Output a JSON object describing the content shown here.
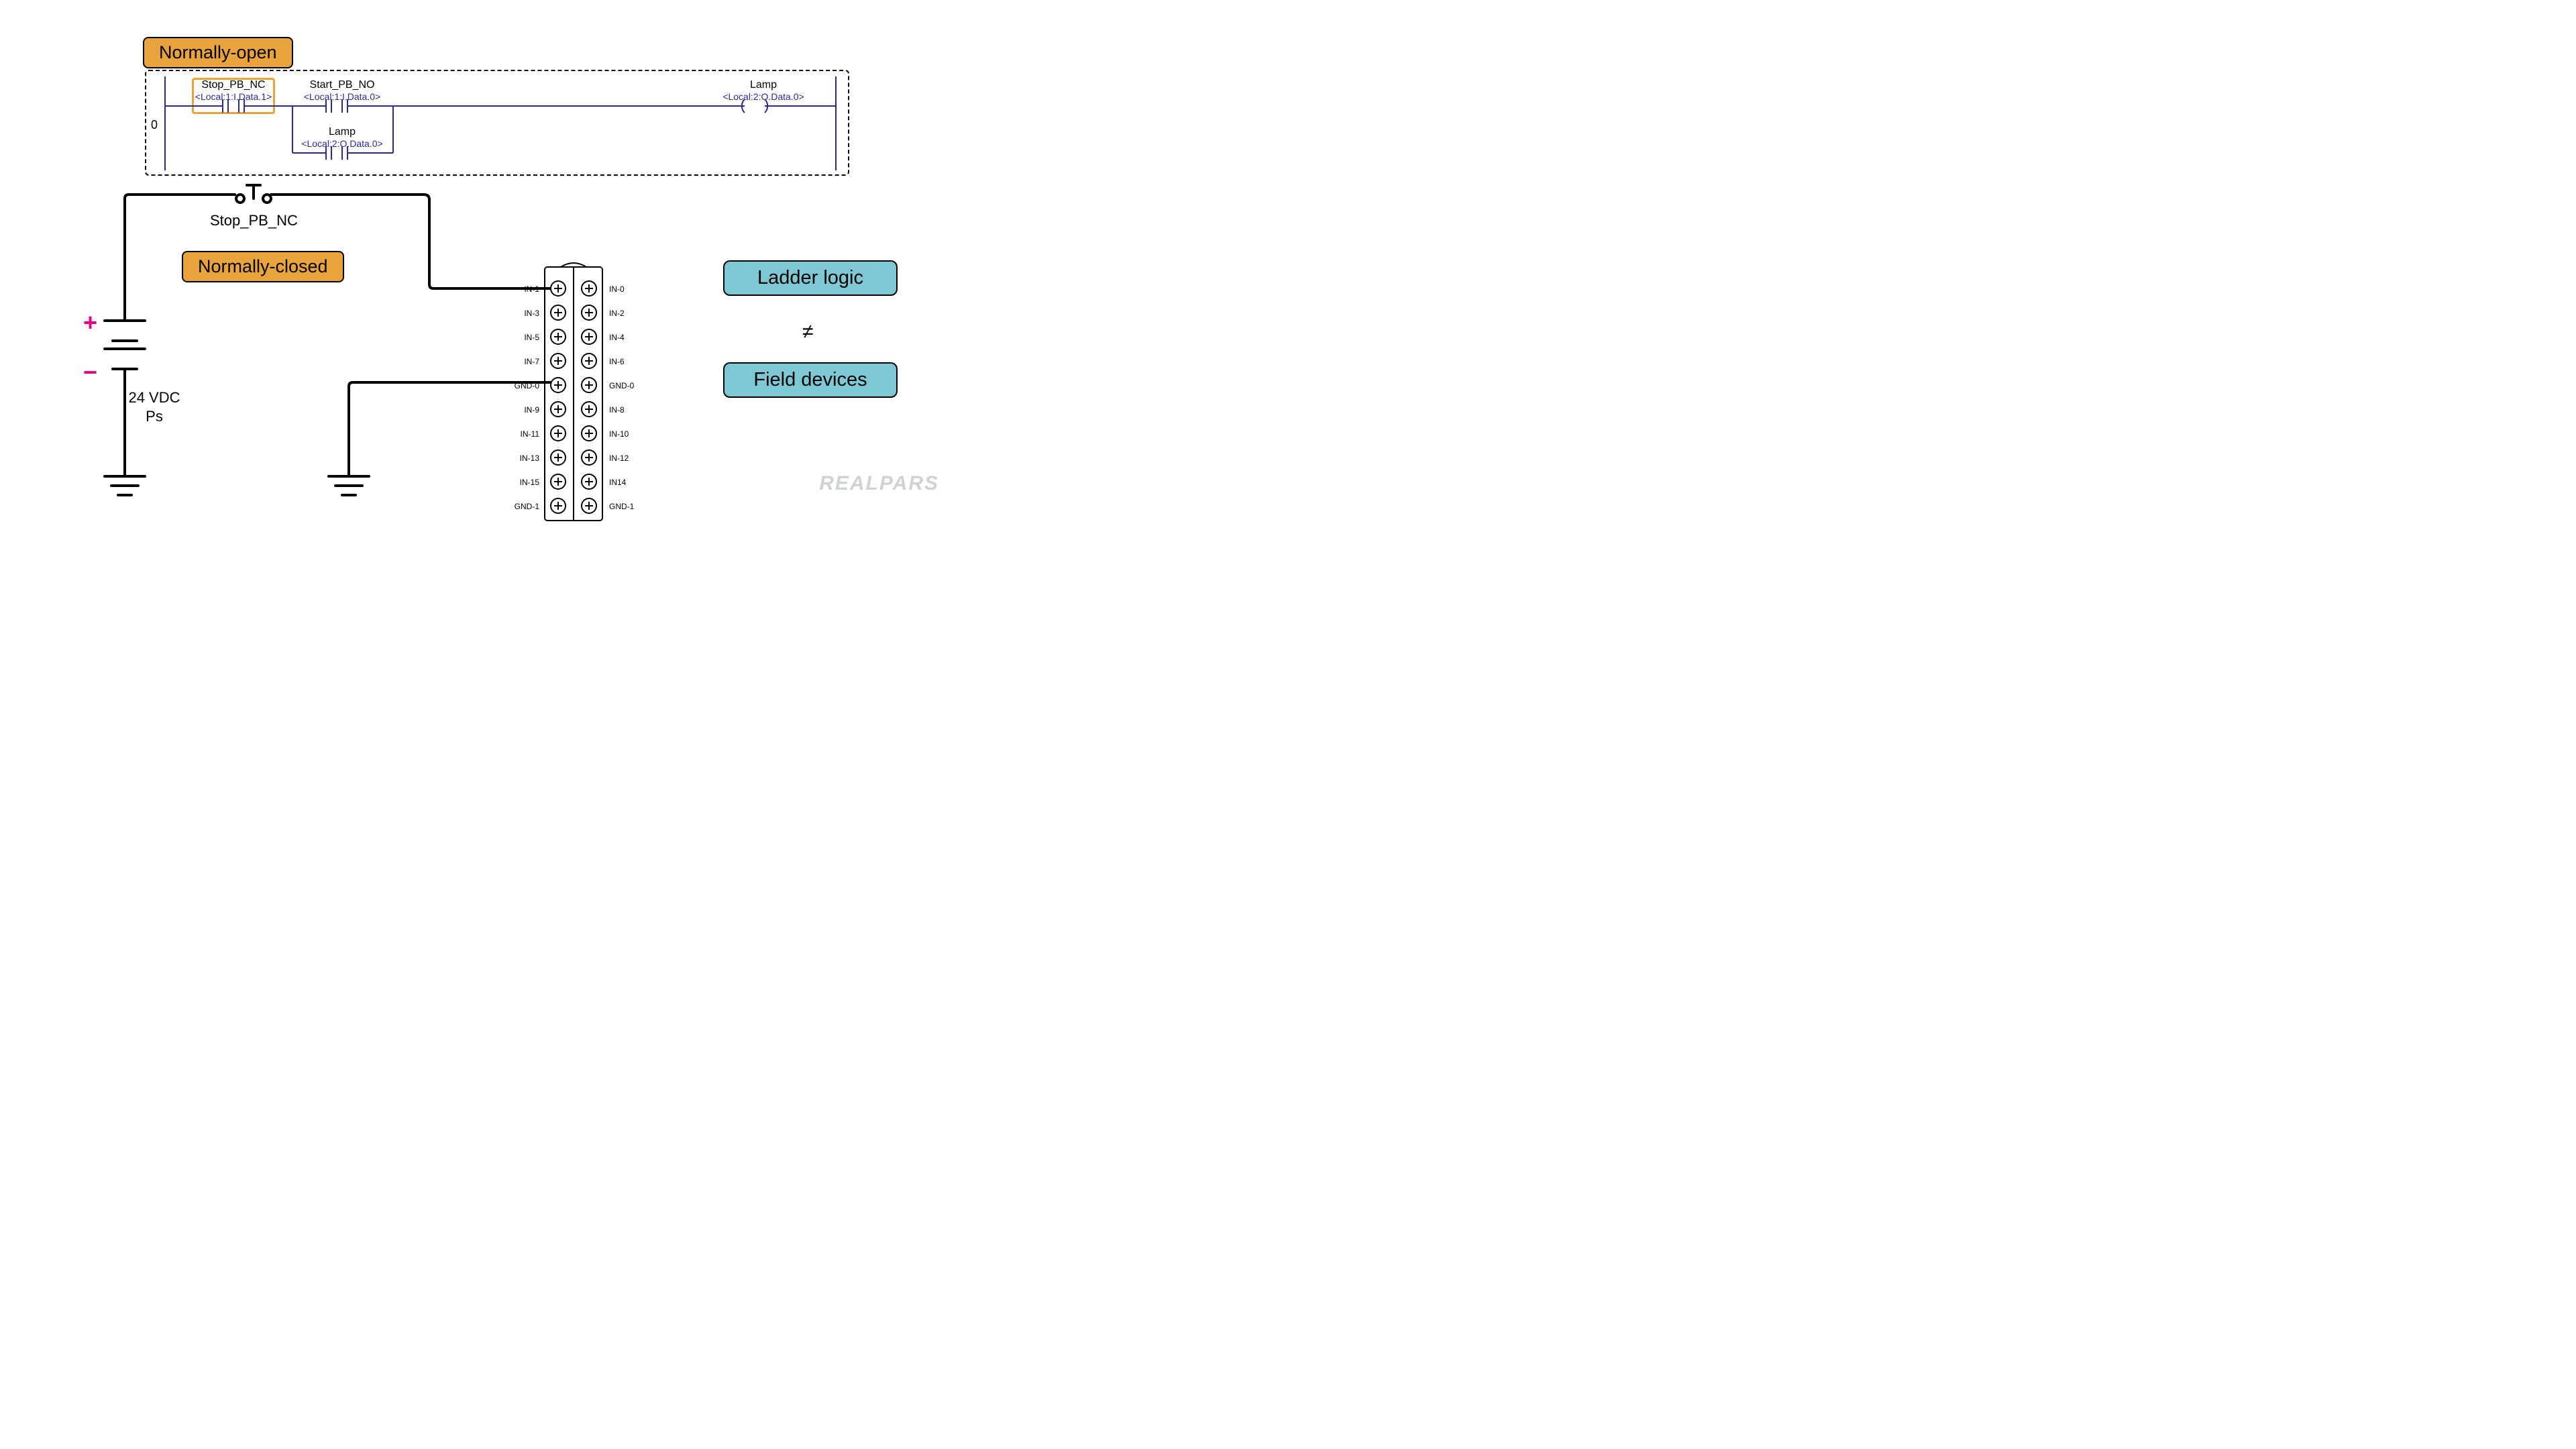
{
  "badges": {
    "normally_open": "Normally-open",
    "normally_closed": "Normally-closed",
    "ladder_logic": "Ladder logic",
    "field_devices": "Field devices"
  },
  "neq_symbol": "≠",
  "ladder": {
    "rung": "0",
    "stop": {
      "tag": "Stop_PB_NC",
      "addr": "<Local:1:I.Data.1>"
    },
    "start": {
      "tag": "Start_PB_NO",
      "addr": "<Local:1:I.Data.0>"
    },
    "lamp_out": {
      "tag": "Lamp",
      "addr": "<Local:2:O.Data.0>"
    },
    "lamp_seal": {
      "tag": "Lamp",
      "addr": "<Local:2:O.Data.0>"
    }
  },
  "wiring": {
    "switch_label": "Stop_PB_NC",
    "ps_voltage": "24 VDC",
    "ps_name": "Ps",
    "plus": "+",
    "minus": "−"
  },
  "terminals": {
    "left": [
      "IN-1",
      "IN-3",
      "IN-5",
      "IN-7",
      "GND-0",
      "IN-9",
      "IN-11",
      "IN-13",
      "IN-15",
      "GND-1"
    ],
    "right": [
      "IN-0",
      "IN-2",
      "IN-4",
      "IN-6",
      "GND-0",
      "IN-8",
      "IN-10",
      "IN-12",
      "IN14",
      "GND-1"
    ]
  },
  "brand": "REALPARS"
}
